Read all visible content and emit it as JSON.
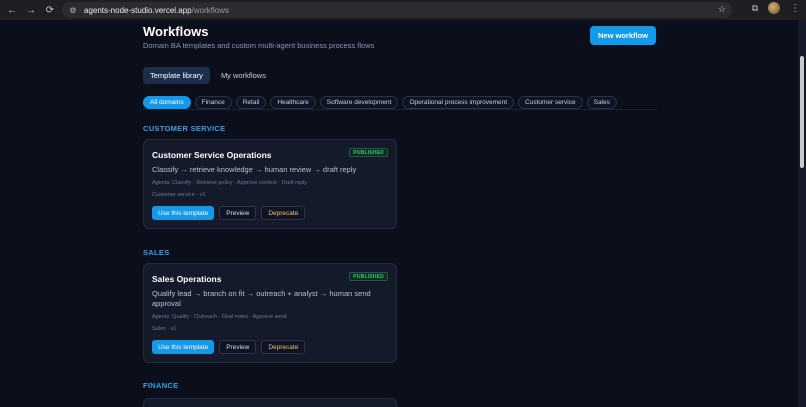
{
  "browser": {
    "url_host": "agents-node-studio.vercel.app",
    "url_path": "/workflows",
    "icons": [
      "back-icon",
      "forward-icon",
      "reload-icon",
      "site-settings-icon",
      "star-icon",
      "extensions-icon",
      "profile-avatar",
      "menu-dots-icon"
    ]
  },
  "header": {
    "title": "Workflows",
    "subtitle": "Domain BA templates and custom multi-agent business process flows",
    "new_button": "New workflow"
  },
  "tabs": [
    {
      "label": "Template library",
      "active": true
    },
    {
      "label": "My workflows",
      "active": false
    }
  ],
  "domains": [
    {
      "label": "All domains",
      "active": true
    },
    {
      "label": "Finance",
      "active": false
    },
    {
      "label": "Retail",
      "active": false
    },
    {
      "label": "Healthcare",
      "active": false
    },
    {
      "label": "Software development",
      "active": false
    },
    {
      "label": "Operational process improvement",
      "active": false
    },
    {
      "label": "Customer service",
      "active": false
    },
    {
      "label": "Sales",
      "active": false
    }
  ],
  "sections": [
    {
      "label": "CUSTOMER SERVICE",
      "card": {
        "title": "Customer Service Operations",
        "badge": "PUBLISHED",
        "description": "Classify → retrieve knowledge → human review → draft reply",
        "agents": "Agents: Classify · Retrieve policy · Approve context · Draft reply",
        "meta": "Customer service · v1",
        "actions": {
          "use": "Use this template",
          "preview": "Preview",
          "deprecate": "Deprecate"
        }
      }
    },
    {
      "label": "SALES",
      "card": {
        "title": "Sales Operations",
        "badge": "PUBLISHED",
        "description": "Qualify lead → branch on fit → outreach + analyst → human send approval",
        "agents": "Agents: Qualify · Outreach · Deal notes · Approve send",
        "meta": "Sales · v1",
        "actions": {
          "use": "Use this template",
          "preview": "Preview",
          "deprecate": "Deprecate"
        }
      }
    },
    {
      "label": "FINANCE"
    }
  ],
  "colors": {
    "background": "#0b0f1c",
    "accent": "#1499e8",
    "section_label": "#3aa0e8",
    "badge_text": "#32c77d",
    "deprecate_text": "#e5c26a"
  }
}
